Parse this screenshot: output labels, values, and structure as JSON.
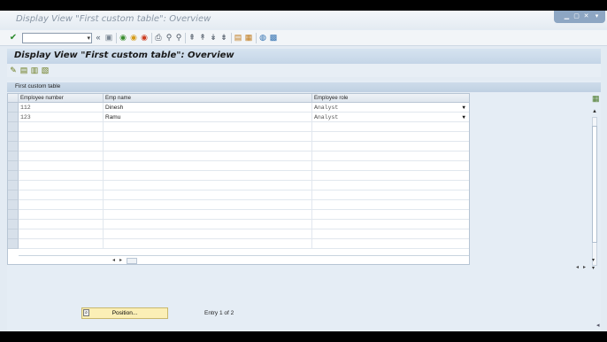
{
  "window": {
    "title": "Display View \"First custom table\": Overview"
  },
  "toolbar": {
    "command_field_value": "",
    "icons": [
      "enter-icon",
      "command-dropdown-icon",
      "back-double-arrow-icon",
      "save-icon",
      "back-icon",
      "exit-icon",
      "cancel-icon",
      "print-icon",
      "find-icon",
      "find-next-icon",
      "first-page-icon",
      "previous-page-icon",
      "next-page-icon",
      "last-page-icon",
      "create-session-icon",
      "shortcut-icon",
      "help-icon",
      "customize-layout-icon"
    ]
  },
  "screen": {
    "title": "Display View \"First custom table\": Overview",
    "app_toolbar_icons": [
      "display-change-icon",
      "select-all-icon",
      "deselect-all-icon",
      "print-list-icon"
    ]
  },
  "table": {
    "title": "First custom table",
    "columns": [
      "Employee number",
      "Emp name",
      "Employee role"
    ],
    "rows": [
      {
        "number": "112",
        "name": "Dinesh",
        "role": "Analyst"
      },
      {
        "number": "123",
        "name": "Ramu",
        "role": "Analyst"
      }
    ],
    "empty_rows": 14
  },
  "footer": {
    "position_label": "Position...",
    "entry_info": "Entry 1 of 2"
  },
  "colors": {
    "background": "#e3ebf3",
    "header_band": "#c4d5e7",
    "position_button": "#fbefb6"
  }
}
